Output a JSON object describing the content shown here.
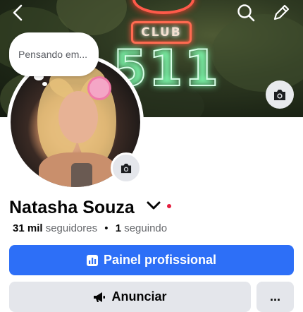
{
  "header": {
    "back_icon": "chevron-left-icon",
    "search_icon": "search-icon",
    "edit_icon": "pencil-icon"
  },
  "cover": {
    "sign_text": "CLUB",
    "sign_number": "511",
    "camera_icon": "camera-icon"
  },
  "bubble": {
    "placeholder": "Pensando em..."
  },
  "profile": {
    "name": "Natasha Souza",
    "followers_count": "31 mil",
    "followers_label": "seguidores",
    "separator": "•",
    "following_count": "1",
    "following_label": "seguindo"
  },
  "actions": {
    "primary_label": "Painel profissional",
    "primary_icon": "chart-icon",
    "secondary_label": "Anunciar",
    "secondary_icon": "megaphone-icon",
    "more_label": "..."
  },
  "colors": {
    "primary": "#2d6ff7",
    "secondary_bg": "#e4e6eb",
    "notification_dot": "#e41e3f"
  }
}
